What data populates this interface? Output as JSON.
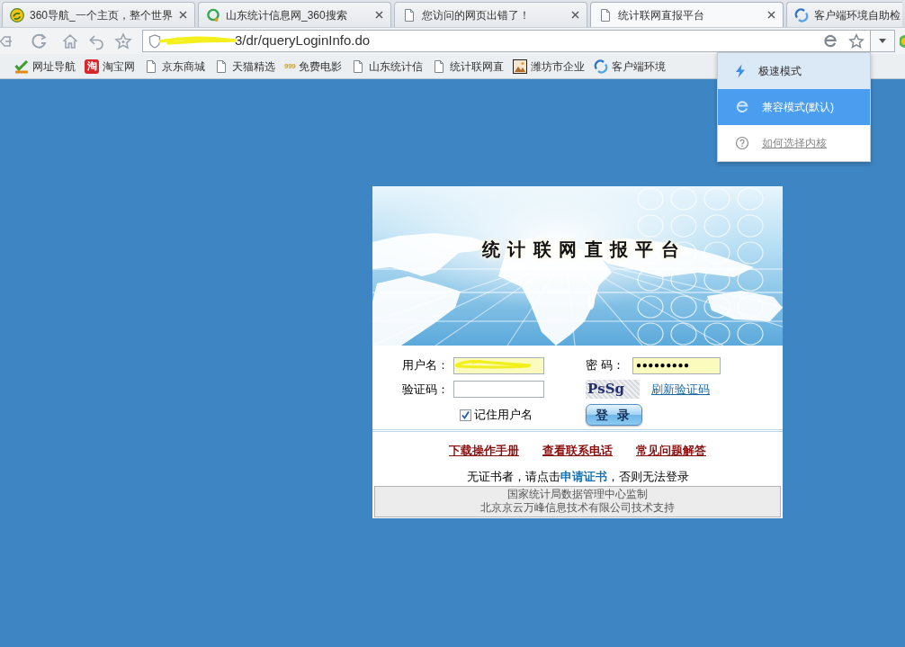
{
  "browser": {
    "tabs": [
      {
        "title": "360导航_一个主页，整个世界",
        "closable": true,
        "selected": false
      },
      {
        "title": "山东统计信息网_360搜索",
        "closable": true,
        "selected": false
      },
      {
        "title": "您访问的网页出错了！",
        "closable": true,
        "selected": false
      },
      {
        "title": "统计联网直报平台",
        "closable": true,
        "selected": true
      },
      {
        "title": "客户端环境自助检",
        "closable": false,
        "selected": false
      }
    ],
    "address": {
      "redacted": true,
      "url": "3/dr/queryLoginInfo.do"
    },
    "bookmarks": [
      {
        "label": "网址导航"
      },
      {
        "label": "淘宝网",
        "logo_text": "淘"
      },
      {
        "label": "京东商城"
      },
      {
        "label": "天猫精选"
      },
      {
        "label": "免费电影",
        "logo_text": "999"
      },
      {
        "label": "山东统计信"
      },
      {
        "label": "统计联网直"
      },
      {
        "label": "潍坊市企业"
      },
      {
        "label": "客户端环境"
      }
    ],
    "kernel_menu": [
      {
        "label": "极速模式",
        "kind": "mode",
        "selected": false
      },
      {
        "label": "兼容模式(默认)",
        "kind": "mode",
        "selected": true
      },
      {
        "label": "如何选择内核",
        "kind": "help",
        "selected": false
      }
    ]
  },
  "login": {
    "banner_title": "统计联网直报平台",
    "username": {
      "label": "用户名：",
      "redacted": true,
      "autofilled": true
    },
    "password": {
      "label": "密 码：",
      "value": "●●●●●●●●●",
      "autofilled": true
    },
    "captcha": {
      "label": "验证码：",
      "autofilled": false,
      "image_text": "PsSg",
      "refresh": "刷新验证码"
    },
    "remember": {
      "label": "记住用户名",
      "checked": true
    },
    "submit": "登 录",
    "links": [
      "下载操作手册",
      "查看联系电话",
      "常见问题解答"
    ],
    "notice": {
      "before": "无证书者，请点击",
      "link": "申请证书",
      "after": "，否则无法登录"
    },
    "footer": [
      "国家统计局数据管理中心监制",
      "北京京云万峰信息技术有限公司技术支持"
    ]
  }
}
